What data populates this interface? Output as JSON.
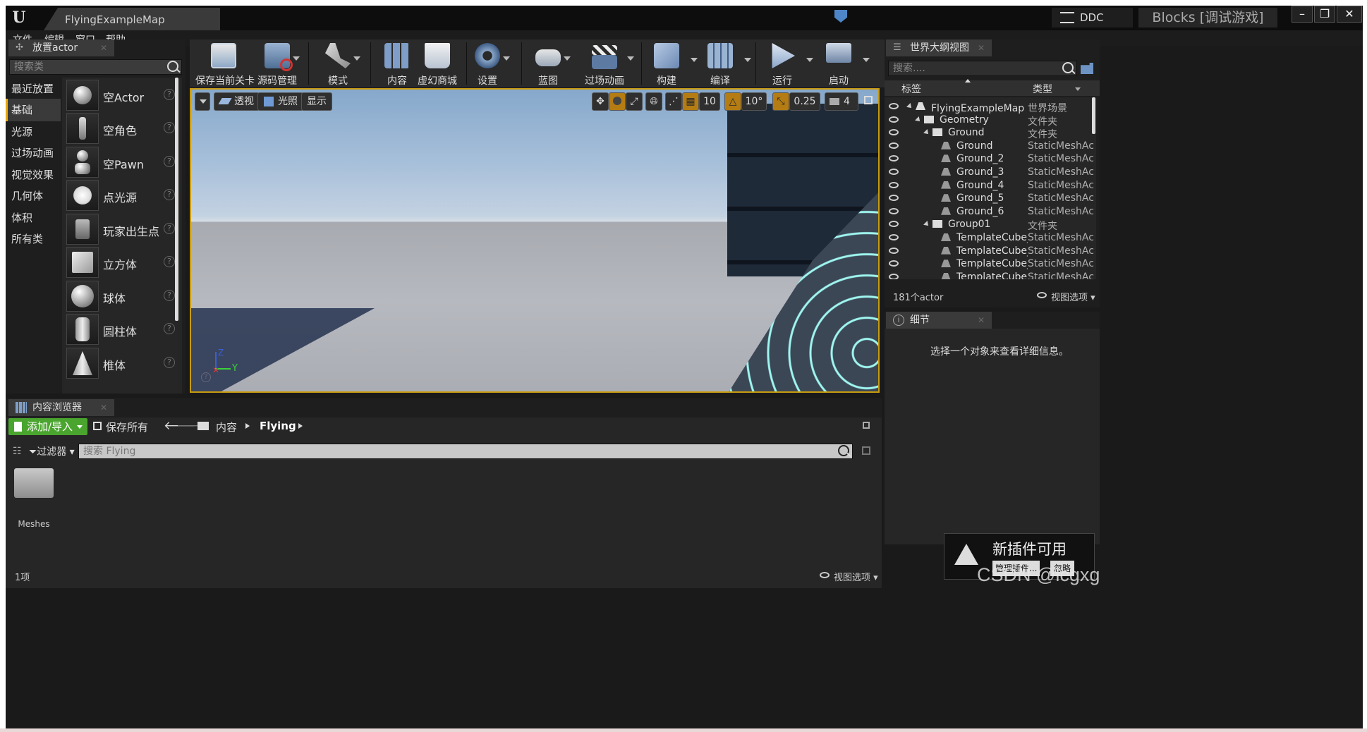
{
  "window": {
    "tab_title": "FlyingExampleMap",
    "ddc_label": "DDC",
    "project_label": "Blocks [调试游戏]",
    "logo_icon": "unreal-logo-icon"
  },
  "menu": [
    "文件",
    "编辑",
    "窗口",
    "帮助"
  ],
  "place_actor": {
    "tab_label": "放置actor",
    "search_placeholder": "搜索类",
    "categories": [
      "最近放置",
      "基础",
      "光源",
      "过场动画",
      "视觉效果",
      "几何体",
      "体积",
      "所有类"
    ],
    "active_category": "基础",
    "items": [
      "空Actor",
      "空角色",
      "空Pawn",
      "点光源",
      "玩家出生点",
      "立方体",
      "球体",
      "圆柱体",
      "椎体"
    ]
  },
  "toolbar": {
    "buttons": [
      "保存当前关卡",
      "源码管理",
      "模式",
      "内容",
      "虚幻商城",
      "设置",
      "蓝图",
      "过场动画",
      "构建",
      "编译",
      "运行",
      "启动"
    ]
  },
  "viewport": {
    "perspective": "透视",
    "lit": "光照",
    "show": "显示",
    "grid_snap": "10",
    "rot_snap": "10°",
    "scale_snap": "0.25",
    "cam_speed": "4",
    "axis_y": "Y",
    "axis_z": "Z"
  },
  "outliner": {
    "tab_label": "世界大纲视图",
    "search_placeholder": "搜索....",
    "col_label": "标签",
    "col_type": "类型",
    "rows": [
      {
        "name": "FlyingExampleMap（编辑",
        "type": "世界场景",
        "indent": 0
      },
      {
        "name": "Geometry",
        "type": "文件夹",
        "indent": 1
      },
      {
        "name": "Ground",
        "type": "文件夹",
        "indent": 2
      },
      {
        "name": "Ground",
        "type": "StaticMeshAc",
        "indent": 3
      },
      {
        "name": "Ground_2",
        "type": "StaticMeshAc",
        "indent": 3
      },
      {
        "name": "Ground_3",
        "type": "StaticMeshAc",
        "indent": 3
      },
      {
        "name": "Ground_4",
        "type": "StaticMeshAc",
        "indent": 3
      },
      {
        "name": "Ground_5",
        "type": "StaticMeshAc",
        "indent": 3
      },
      {
        "name": "Ground_6",
        "type": "StaticMeshAc",
        "indent": 3
      },
      {
        "name": "Group01",
        "type": "文件夹",
        "indent": 2
      },
      {
        "name": "TemplateCube_Rou",
        "type": "StaticMeshAc",
        "indent": 3
      },
      {
        "name": "TemplateCube_Rou",
        "type": "StaticMeshAc",
        "indent": 3
      },
      {
        "name": "TemplateCube_Rou",
        "type": "StaticMeshAc",
        "indent": 3
      },
      {
        "name": "TemplateCube_Rou",
        "type": "StaticMeshAc",
        "indent": 3
      }
    ],
    "actor_count": "181个actor",
    "view_options": "视图选项"
  },
  "details": {
    "tab_label": "细节",
    "hint": "选择一个对象来查看详细信息。"
  },
  "content_browser": {
    "tab_label": "内容浏览器",
    "add_import": "添加/导入",
    "save_all": "保存所有",
    "path_root": "内容",
    "path_current": "Flying",
    "filters": "过滤器",
    "search_placeholder": "搜索 Flying",
    "folder_name": "Meshes",
    "item_count": "1项",
    "view_options": "视图选项"
  },
  "notification": {
    "title": "新插件可用",
    "manage": "管理插件...",
    "ignore": "忽略"
  },
  "watermark": "CSDN @lcgxg",
  "colors": {
    "accent": "#e8a90b",
    "add_button": "#4aa52e",
    "panel": "#262626"
  }
}
